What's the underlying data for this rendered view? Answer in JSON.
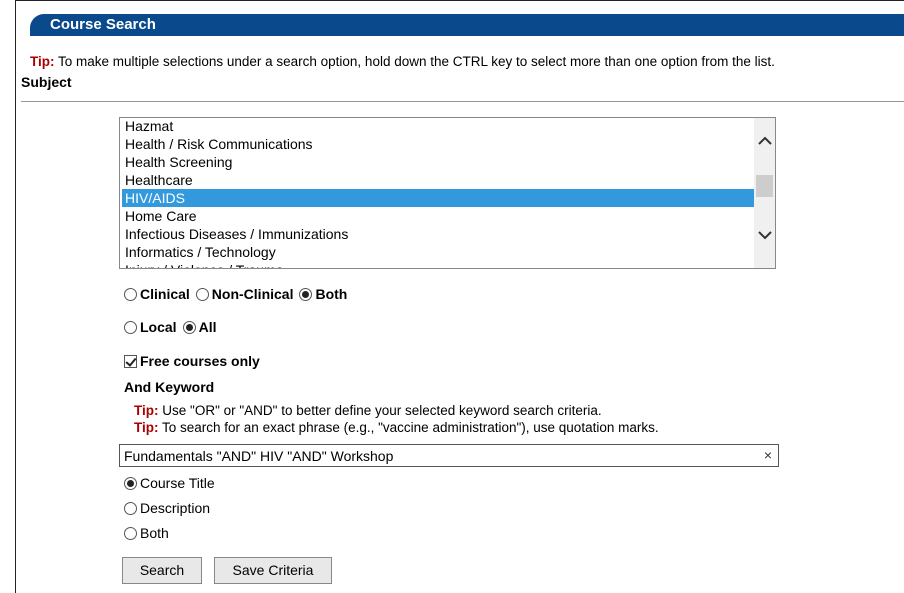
{
  "header": {
    "title": "Course Search"
  },
  "tip_main": {
    "label": "Tip:",
    "text": "To make multiple selections under a search option, hold down the CTRL key to select more than one option from the list."
  },
  "subject": {
    "label": "Subject",
    "items": [
      "Hazmat",
      "Health / Risk Communications",
      "Health Screening",
      "Healthcare",
      "HIV/AIDS",
      "Home Care",
      "Infectious Diseases / Immunizations",
      "Informatics / Technology",
      "Injury / Violence / Trauma"
    ],
    "selected": "HIV/AIDS"
  },
  "clinical_options": {
    "options": [
      "Clinical",
      "Non-Clinical",
      "Both"
    ],
    "selected": "Both"
  },
  "scope_options": {
    "options": [
      "Local",
      "All"
    ],
    "selected": "All"
  },
  "free_courses": {
    "label": "Free courses only",
    "checked": true
  },
  "keyword": {
    "label": "And Keyword",
    "tip1_label": "Tip:",
    "tip1_text": "Use \"OR\" or \"AND\" to better define your selected keyword search criteria.",
    "tip2_label": "Tip:",
    "tip2_text": "To search for an exact phrase (e.g., \"vaccine administration\"), use quotation marks.",
    "value": "Fundamentals \"AND\" HIV \"AND\" Workshop",
    "clear_symbol": "×"
  },
  "field_options": {
    "options": [
      "Course Title",
      "Description",
      "Both"
    ],
    "selected": "Course Title"
  },
  "buttons": {
    "search": "Search",
    "save": "Save Criteria"
  },
  "icons": {
    "scroll_up": "chevron-up-icon",
    "scroll_down": "chevron-down-icon"
  },
  "colors": {
    "header_bg": "#0a4a8c",
    "tip": "#aa0000",
    "selection": "#3399dd"
  }
}
